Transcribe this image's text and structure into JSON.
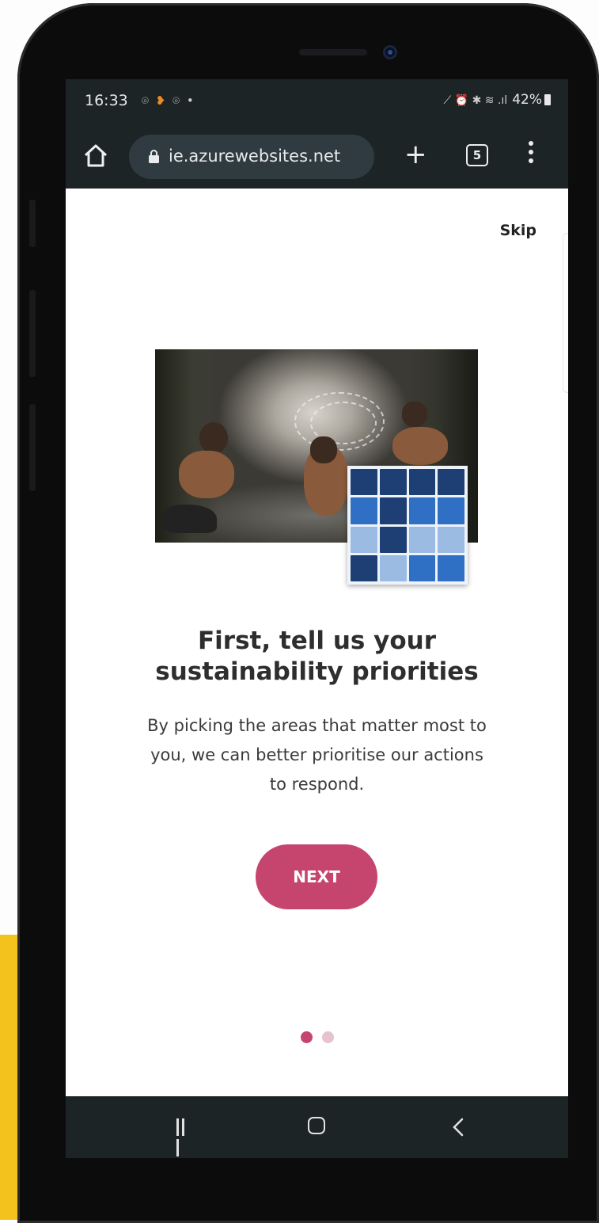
{
  "status_bar": {
    "time": "16:33",
    "left_icons": "⌾ ❥ ⌾ •",
    "right_icons": "⟋ ⏰ ✱ ≋ .ıl",
    "battery": "42%"
  },
  "browser": {
    "url": "ie.azurewebsites.net",
    "tab_count": "5"
  },
  "onboarding": {
    "skip_label": "Skip",
    "headline_line1": "First, tell us your",
    "headline_line2": "sustainability priorities",
    "body_line1": "By picking the areas that matter most to",
    "body_line2": "you, we can better prioritise our actions",
    "body_line3": "to respond.",
    "next_label": "NEXT",
    "current_page": 1,
    "total_pages": 2
  },
  "colors": {
    "accent": "#c5456f",
    "accent_light": "#e7c2cf",
    "chrome_bar": "#1d2426",
    "background_yellow": "#f4c21c"
  },
  "icons": {
    "home": "home-icon",
    "lock": "lock-icon",
    "new_tab": "plus-icon",
    "tabs": "tabs-icon",
    "menu": "more-vert-icon",
    "nav_recents": "recents-icon",
    "nav_home": "home-circle-icon",
    "nav_back": "back-icon"
  }
}
